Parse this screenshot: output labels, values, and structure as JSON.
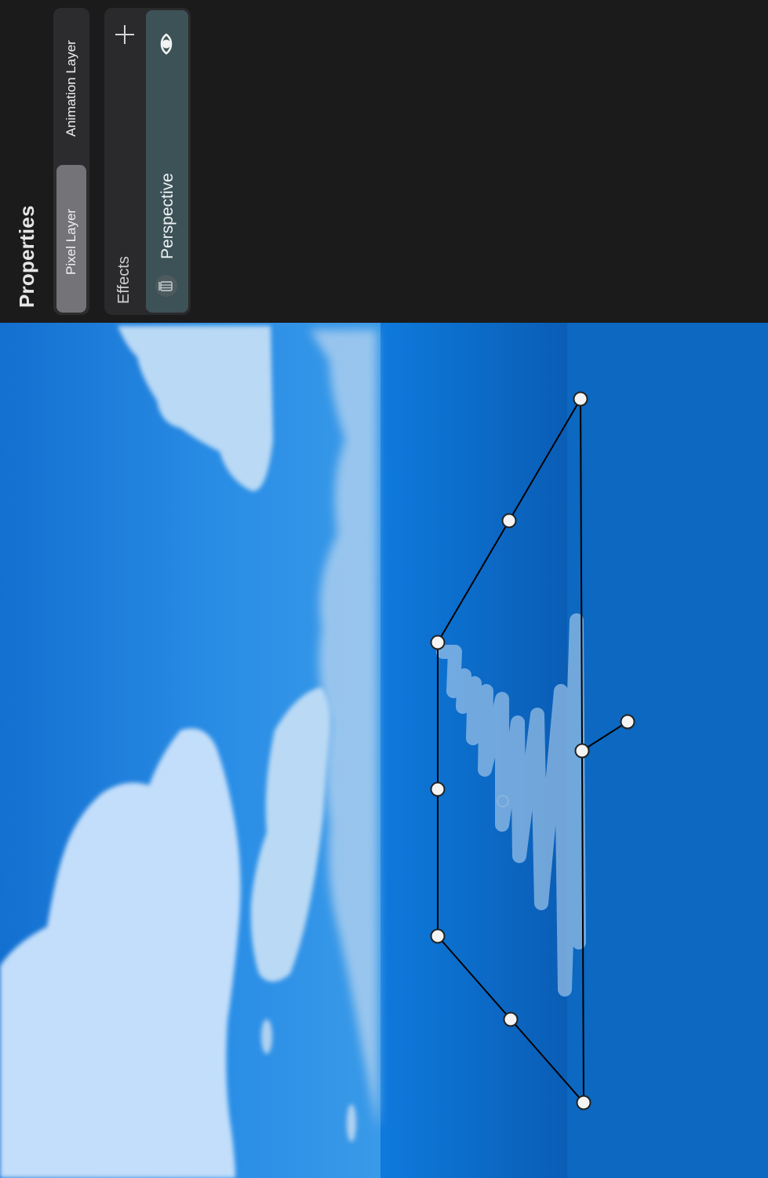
{
  "panel": {
    "title": "Properties",
    "layer_types": [
      "Pixel Layer",
      "Animation Layer"
    ],
    "selected_layer_type": "Pixel Layer",
    "effects_label": "Effects",
    "effects": [
      {
        "label": "Perspective",
        "visible": true
      }
    ]
  },
  "colors": {
    "panel_bg": "#1b1b1c",
    "effect_item_bg": "#3d5257",
    "sky": "#1f82dd",
    "sea": "#0c6fcc"
  },
  "icons": {
    "add": "plus-icon",
    "visibility": "eye-icon",
    "delete": "trash-icon"
  }
}
